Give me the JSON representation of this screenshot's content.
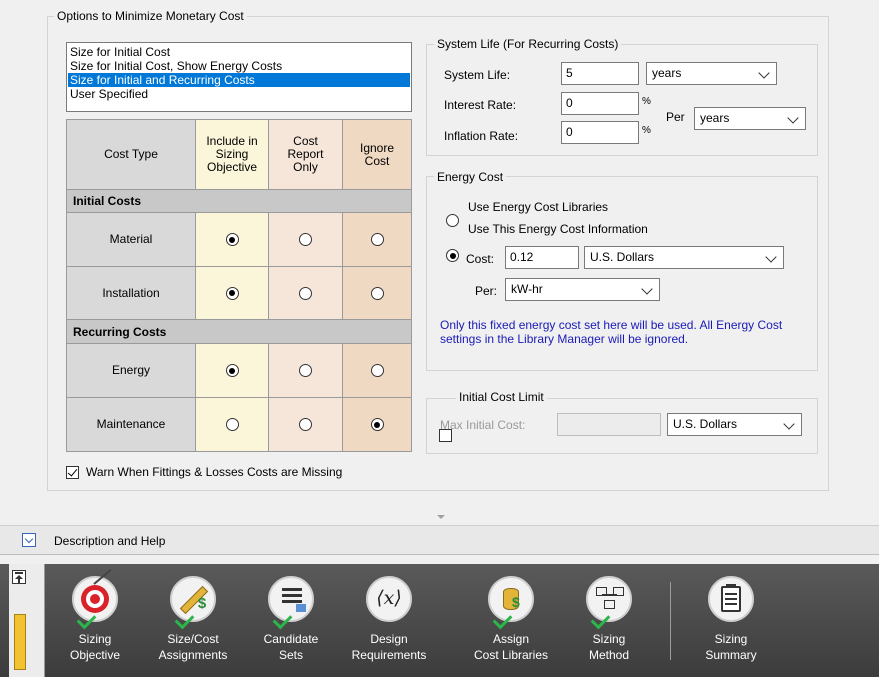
{
  "options_group": {
    "title": "Options to Minimize Monetary Cost",
    "list_items": [
      {
        "label": "Size for Initial Cost",
        "selected": false
      },
      {
        "label": "Size for Initial Cost, Show Energy Costs",
        "selected": false
      },
      {
        "label": "Size for Initial and Recurring Costs",
        "selected": true
      },
      {
        "label": "User Specified",
        "selected": false
      }
    ]
  },
  "cost_table": {
    "headers": {
      "cost_type": "Cost Type",
      "include": "Include in Sizing Objective",
      "report": "Cost Report Only",
      "ignore": "Ignore Cost"
    },
    "sections": [
      {
        "title": "Initial Costs",
        "rows": [
          {
            "label": "Material",
            "selected": "include"
          },
          {
            "label": "Installation",
            "selected": "include"
          }
        ]
      },
      {
        "title": "Recurring Costs",
        "rows": [
          {
            "label": "Energy",
            "selected": "include"
          },
          {
            "label": "Maintenance",
            "selected": "ignore"
          }
        ]
      }
    ]
  },
  "warn_checkbox": {
    "label": "Warn When Fittings & Losses Costs are Missing",
    "checked": true
  },
  "system_life": {
    "title": "System Life (For Recurring Costs)",
    "life_label": "System Life:",
    "life_value": "5",
    "life_unit": "years",
    "interest_label": "Interest Rate:",
    "interest_value": "0",
    "inflation_label": "Inflation Rate:",
    "inflation_value": "0",
    "percent_symbol": "%",
    "per_label": "Per",
    "per_unit": "years"
  },
  "energy_cost": {
    "title": "Energy Cost",
    "option_libraries": "Use Energy Cost Libraries",
    "option_this": "Use This Energy Cost Information",
    "selected": "this",
    "cost_label": "Cost:",
    "cost_value": "0.12",
    "currency": "U.S. Dollars",
    "per_label": "Per:",
    "per_value": "kW-hr",
    "info": "Only this fixed energy cost set here will be used. All Energy Cost settings in the Library Manager will be ignored."
  },
  "initial_cost_limit": {
    "label": "Initial Cost Limit",
    "checked": false,
    "max_label": "Max Initial Cost:",
    "max_value": "",
    "currency": "U.S. Dollars"
  },
  "help": {
    "label": "Description and Help"
  },
  "toolbar": {
    "tools": [
      {
        "line1": "Sizing",
        "line2": "Objective",
        "icon": "target-icon"
      },
      {
        "line1": "Size/Cost",
        "line2": "Assignments",
        "icon": "ruler-dollar-icon"
      },
      {
        "line1": "Candidate",
        "line2": "Sets",
        "icon": "list-icon"
      },
      {
        "line1": "Design",
        "line2": "Requirements",
        "icon": "variable-x-icon"
      },
      {
        "line1": "Assign",
        "line2": "Cost Libraries",
        "icon": "coins-icon"
      },
      {
        "line1": "Sizing",
        "line2": "Method",
        "icon": "flowchart-icon"
      },
      {
        "line1": "Sizing",
        "line2": "Summary",
        "icon": "clipboard-icon"
      }
    ]
  },
  "colors": {
    "selection": "#0078d7",
    "info_text": "#1a1ab8",
    "toolbar_bg": "#4a4a4a",
    "check_green": "#2bb54a"
  }
}
